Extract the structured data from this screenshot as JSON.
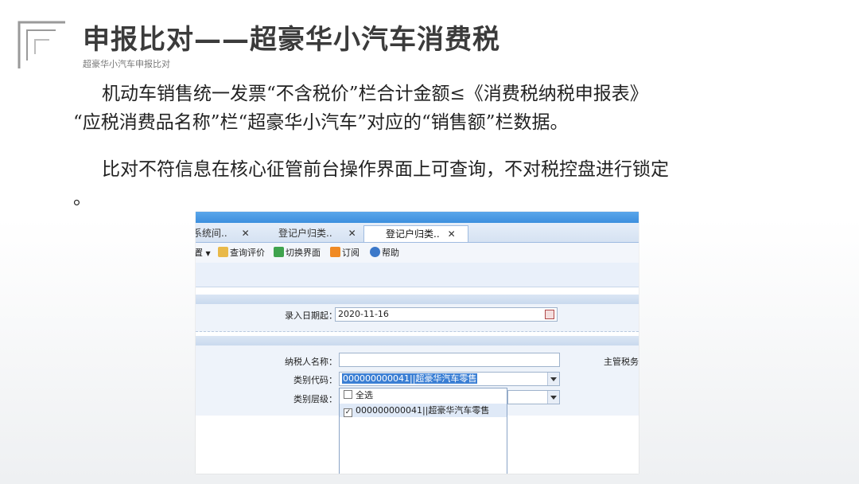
{
  "slide": {
    "title": "申报比对——超豪华小汽车消费税",
    "subtitle": "超豪华小汽车申报比对",
    "para1_line1": "机动车销售统一发票“不含税价”栏合计金额≤《消费税纳税申报表》",
    "para1_line2": "“应税消费品名称”栏“超豪华小汽车”对应的“销售额”栏数据。",
    "para2_line1": "比对不符信息在核心征管前台操作界面上可查询，不对税控盘进行锁定",
    "para2_line2": "。"
  },
  "app": {
    "tabs": [
      {
        "label": "系统间..",
        "close": "✕"
      },
      {
        "label": "登记户归类..",
        "close": "✕"
      },
      {
        "label": "登记户归类..",
        "close": "✕"
      }
    ],
    "toolbar": {
      "partial": "置",
      "query_eval": "查询评价",
      "switch_view": "切换界面",
      "subscribe": "订阅",
      "help": "帮助"
    },
    "form": {
      "entry_date_label": "录入日期起：",
      "entry_date_value": "2020-11-16",
      "taxpayer_name_label": "纳税人名称：",
      "taxpayer_name_value": "",
      "category_code_label": "类别代码：",
      "category_code_value": "000000000041||超豪华汽车零售",
      "category_level_label": "类别层级：",
      "tax_office_label": "主管税务"
    },
    "dropdown": {
      "select_all": "全选",
      "option": "000000000041||超豪华汽车零售",
      "option_checked": true
    }
  },
  "colors": {
    "accent": "#3c8fde",
    "selection": "#3b7fd4"
  }
}
